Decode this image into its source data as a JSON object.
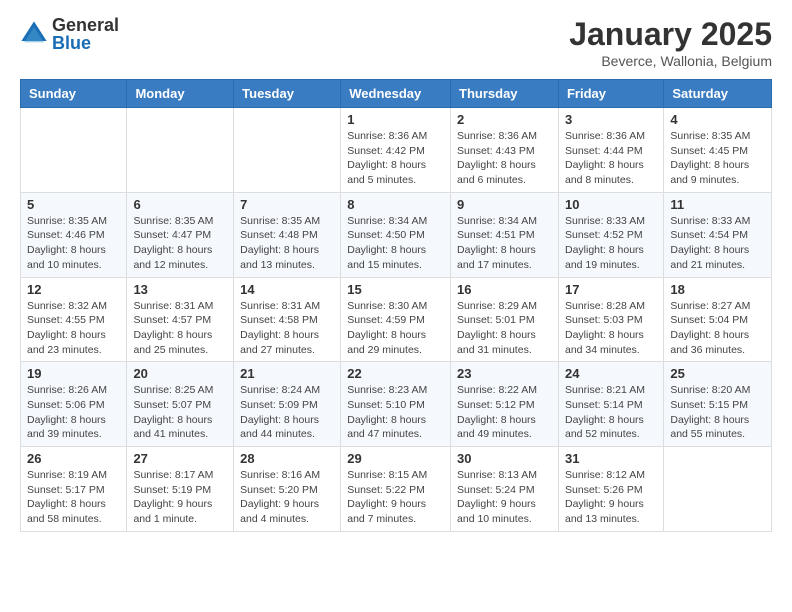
{
  "logo": {
    "general": "General",
    "blue": "Blue"
  },
  "title": "January 2025",
  "location": "Beverce, Wallonia, Belgium",
  "weekdays": [
    "Sunday",
    "Monday",
    "Tuesday",
    "Wednesday",
    "Thursday",
    "Friday",
    "Saturday"
  ],
  "weeks": [
    [
      {
        "day": "",
        "info": ""
      },
      {
        "day": "",
        "info": ""
      },
      {
        "day": "",
        "info": ""
      },
      {
        "day": "1",
        "info": "Sunrise: 8:36 AM\nSunset: 4:42 PM\nDaylight: 8 hours\nand 5 minutes."
      },
      {
        "day": "2",
        "info": "Sunrise: 8:36 AM\nSunset: 4:43 PM\nDaylight: 8 hours\nand 6 minutes."
      },
      {
        "day": "3",
        "info": "Sunrise: 8:36 AM\nSunset: 4:44 PM\nDaylight: 8 hours\nand 8 minutes."
      },
      {
        "day": "4",
        "info": "Sunrise: 8:35 AM\nSunset: 4:45 PM\nDaylight: 8 hours\nand 9 minutes."
      }
    ],
    [
      {
        "day": "5",
        "info": "Sunrise: 8:35 AM\nSunset: 4:46 PM\nDaylight: 8 hours\nand 10 minutes."
      },
      {
        "day": "6",
        "info": "Sunrise: 8:35 AM\nSunset: 4:47 PM\nDaylight: 8 hours\nand 12 minutes."
      },
      {
        "day": "7",
        "info": "Sunrise: 8:35 AM\nSunset: 4:48 PM\nDaylight: 8 hours\nand 13 minutes."
      },
      {
        "day": "8",
        "info": "Sunrise: 8:34 AM\nSunset: 4:50 PM\nDaylight: 8 hours\nand 15 minutes."
      },
      {
        "day": "9",
        "info": "Sunrise: 8:34 AM\nSunset: 4:51 PM\nDaylight: 8 hours\nand 17 minutes."
      },
      {
        "day": "10",
        "info": "Sunrise: 8:33 AM\nSunset: 4:52 PM\nDaylight: 8 hours\nand 19 minutes."
      },
      {
        "day": "11",
        "info": "Sunrise: 8:33 AM\nSunset: 4:54 PM\nDaylight: 8 hours\nand 21 minutes."
      }
    ],
    [
      {
        "day": "12",
        "info": "Sunrise: 8:32 AM\nSunset: 4:55 PM\nDaylight: 8 hours\nand 23 minutes."
      },
      {
        "day": "13",
        "info": "Sunrise: 8:31 AM\nSunset: 4:57 PM\nDaylight: 8 hours\nand 25 minutes."
      },
      {
        "day": "14",
        "info": "Sunrise: 8:31 AM\nSunset: 4:58 PM\nDaylight: 8 hours\nand 27 minutes."
      },
      {
        "day": "15",
        "info": "Sunrise: 8:30 AM\nSunset: 4:59 PM\nDaylight: 8 hours\nand 29 minutes."
      },
      {
        "day": "16",
        "info": "Sunrise: 8:29 AM\nSunset: 5:01 PM\nDaylight: 8 hours\nand 31 minutes."
      },
      {
        "day": "17",
        "info": "Sunrise: 8:28 AM\nSunset: 5:03 PM\nDaylight: 8 hours\nand 34 minutes."
      },
      {
        "day": "18",
        "info": "Sunrise: 8:27 AM\nSunset: 5:04 PM\nDaylight: 8 hours\nand 36 minutes."
      }
    ],
    [
      {
        "day": "19",
        "info": "Sunrise: 8:26 AM\nSunset: 5:06 PM\nDaylight: 8 hours\nand 39 minutes."
      },
      {
        "day": "20",
        "info": "Sunrise: 8:25 AM\nSunset: 5:07 PM\nDaylight: 8 hours\nand 41 minutes."
      },
      {
        "day": "21",
        "info": "Sunrise: 8:24 AM\nSunset: 5:09 PM\nDaylight: 8 hours\nand 44 minutes."
      },
      {
        "day": "22",
        "info": "Sunrise: 8:23 AM\nSunset: 5:10 PM\nDaylight: 8 hours\nand 47 minutes."
      },
      {
        "day": "23",
        "info": "Sunrise: 8:22 AM\nSunset: 5:12 PM\nDaylight: 8 hours\nand 49 minutes."
      },
      {
        "day": "24",
        "info": "Sunrise: 8:21 AM\nSunset: 5:14 PM\nDaylight: 8 hours\nand 52 minutes."
      },
      {
        "day": "25",
        "info": "Sunrise: 8:20 AM\nSunset: 5:15 PM\nDaylight: 8 hours\nand 55 minutes."
      }
    ],
    [
      {
        "day": "26",
        "info": "Sunrise: 8:19 AM\nSunset: 5:17 PM\nDaylight: 8 hours\nand 58 minutes."
      },
      {
        "day": "27",
        "info": "Sunrise: 8:17 AM\nSunset: 5:19 PM\nDaylight: 9 hours\nand 1 minute."
      },
      {
        "day": "28",
        "info": "Sunrise: 8:16 AM\nSunset: 5:20 PM\nDaylight: 9 hours\nand 4 minutes."
      },
      {
        "day": "29",
        "info": "Sunrise: 8:15 AM\nSunset: 5:22 PM\nDaylight: 9 hours\nand 7 minutes."
      },
      {
        "day": "30",
        "info": "Sunrise: 8:13 AM\nSunset: 5:24 PM\nDaylight: 9 hours\nand 10 minutes."
      },
      {
        "day": "31",
        "info": "Sunrise: 8:12 AM\nSunset: 5:26 PM\nDaylight: 9 hours\nand 13 minutes."
      },
      {
        "day": "",
        "info": ""
      }
    ]
  ]
}
